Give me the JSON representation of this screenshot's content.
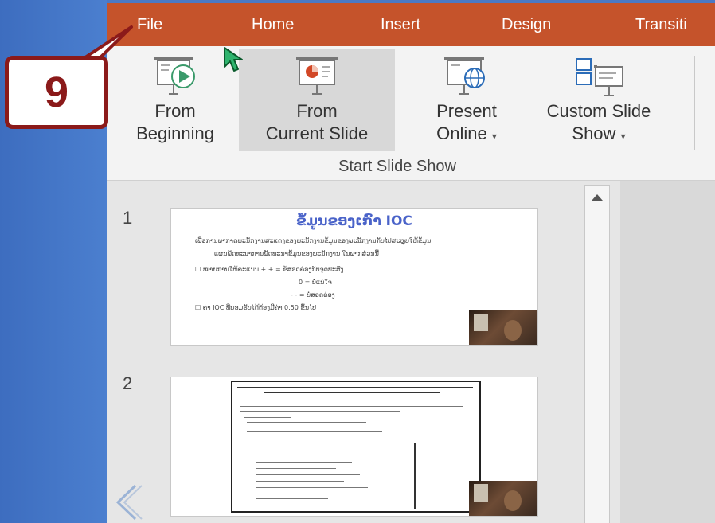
{
  "ribbon": {
    "tabs": [
      {
        "label": "File"
      },
      {
        "label": "Home"
      },
      {
        "label": "Insert"
      },
      {
        "label": "Design"
      },
      {
        "label": "Transiti"
      }
    ],
    "buttons": {
      "from_beginning": {
        "line1": "From",
        "line2": "Beginning"
      },
      "from_current": {
        "line1": "From",
        "line2": "Current Slide"
      },
      "present_online": {
        "line1": "Present",
        "line2": "Online"
      },
      "custom_show": {
        "line1": "Custom Slide",
        "line2": "Show"
      }
    },
    "dropdown_caret": "▾",
    "group_label": "Start Slide Show"
  },
  "slides": [
    {
      "number": "1",
      "title": "ຂໍ້ມູນຂອງເກົາ IOC",
      "lines": [
        "ເພື່ອການພາກາດພະນັກງານສະແດງຂອງພະນັກງານຂໍ້ມູນຂອງພະນັກງານກັບໄປສະຫຼຸບໃຫ້ຂໍ້ມູນ",
        "ແຜນພັດທະນາການພັດທະນາຂໍ້ມູນຂອງພະນັກງານ ໃນພາກສ່ວນນີ້",
        "☐ ໝາຍການໃຫ້ຄະແນນ   + + = ຂໍ້ສອດຄ່ອງກັບຈຸດປະສົງ",
        "0 = ບໍ່ແນ່ໃຈ",
        "- - = ບໍ່ສອດຄ່ອງ",
        "☐ ຄ່າ IOC ທີ່ຍອມຮັບໄດ້ຕ້ອງມີຄ່າ 0.50 ຂຶ້ນໄປ"
      ]
    },
    {
      "number": "2"
    }
  ],
  "annotation": {
    "step_number": "9"
  },
  "colors": {
    "tab_bar": "#c5532b",
    "badge_border": "#8b1a1a",
    "background": "#4a79c6"
  }
}
